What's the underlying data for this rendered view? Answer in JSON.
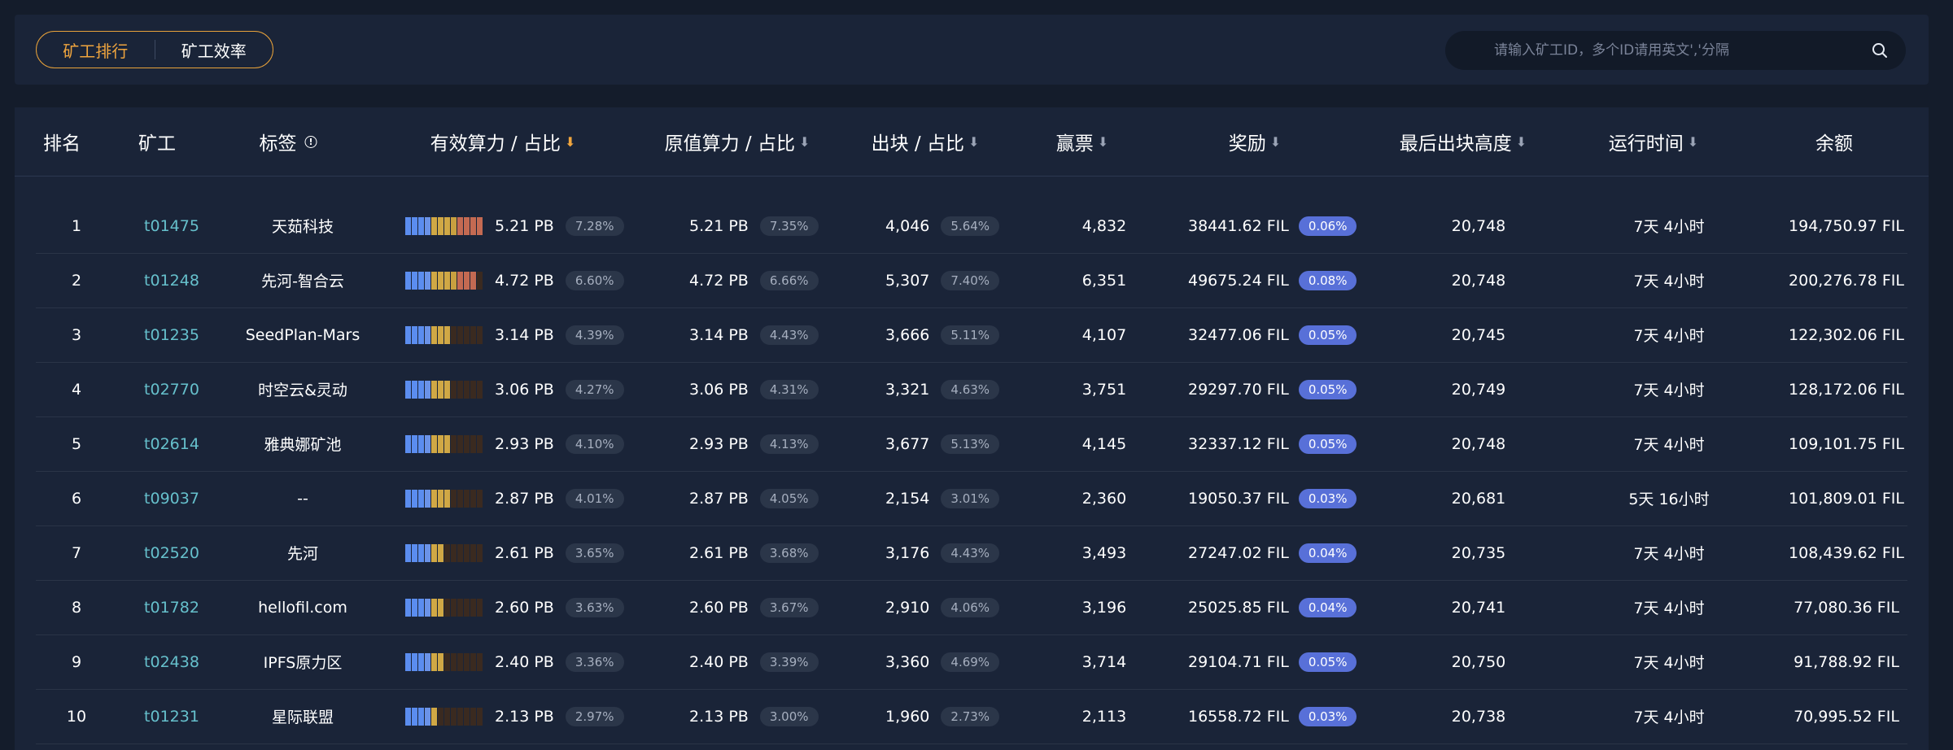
{
  "tabs": [
    {
      "label": "矿工排行",
      "active": true
    },
    {
      "label": "矿工效率",
      "active": false
    }
  ],
  "search": {
    "placeholder": "请输入矿工ID，多个ID请用英文','分隔",
    "icon": "search-icon"
  },
  "headers": {
    "rank": "排名",
    "miner": "矿工",
    "tag": "标签",
    "eff_power": "有效算力 / 占比",
    "raw_power": "原值算力 / 占比",
    "blocks": "出块 / 占比",
    "wins": "赢票",
    "reward": "奖励",
    "last_height": "最后出块高度",
    "runtime": "运行时间",
    "balance": "余额"
  },
  "colors": {
    "accent": "#f0a53e",
    "miner_link": "#66c0cc",
    "reward_pill": "#5870d8",
    "background": "#141c2b"
  },
  "rows": [
    {
      "rank": "1",
      "miner": "t01475",
      "tag": "天茹科技",
      "eff": "5.21 PB",
      "eff_pct": "7.28%",
      "eff_fraction": 1.0,
      "raw": "5.21 PB",
      "raw_pct": "7.35%",
      "blocks": "4,046",
      "blocks_pct": "5.64%",
      "wins": "4,832",
      "reward": "38441.62 FIL",
      "reward_pct": "0.06%",
      "height": "20,748",
      "runtime": "7天 4小时",
      "balance": "194,750.97 FIL"
    },
    {
      "rank": "2",
      "miner": "t01248",
      "tag": "先河-智合云",
      "eff": "4.72 PB",
      "eff_pct": "6.60%",
      "eff_fraction": 0.91,
      "raw": "4.72 PB",
      "raw_pct": "6.66%",
      "blocks": "5,307",
      "blocks_pct": "7.40%",
      "wins": "6,351",
      "reward": "49675.24 FIL",
      "reward_pct": "0.08%",
      "height": "20,748",
      "runtime": "7天 4小时",
      "balance": "200,276.78 FIL"
    },
    {
      "rank": "3",
      "miner": "t01235",
      "tag": "SeedPlan-Mars",
      "eff": "3.14 PB",
      "eff_pct": "4.39%",
      "eff_fraction": 0.6,
      "raw": "3.14 PB",
      "raw_pct": "4.43%",
      "blocks": "3,666",
      "blocks_pct": "5.11%",
      "wins": "4,107",
      "reward": "32477.06 FIL",
      "reward_pct": "0.05%",
      "height": "20,745",
      "runtime": "7天 4小时",
      "balance": "122,302.06 FIL"
    },
    {
      "rank": "4",
      "miner": "t02770",
      "tag": "时空云&灵动",
      "eff": "3.06 PB",
      "eff_pct": "4.27%",
      "eff_fraction": 0.59,
      "raw": "3.06 PB",
      "raw_pct": "4.31%",
      "blocks": "3,321",
      "blocks_pct": "4.63%",
      "wins": "3,751",
      "reward": "29297.70 FIL",
      "reward_pct": "0.05%",
      "height": "20,749",
      "runtime": "7天 4小时",
      "balance": "128,172.06 FIL"
    },
    {
      "rank": "5",
      "miner": "t02614",
      "tag": "雅典娜矿池",
      "eff": "2.93 PB",
      "eff_pct": "4.10%",
      "eff_fraction": 0.56,
      "raw": "2.93 PB",
      "raw_pct": "4.13%",
      "blocks": "3,677",
      "blocks_pct": "5.13%",
      "wins": "4,145",
      "reward": "32337.12 FIL",
      "reward_pct": "0.05%",
      "height": "20,748",
      "runtime": "7天 4小时",
      "balance": "109,101.75 FIL"
    },
    {
      "rank": "6",
      "miner": "t09037",
      "tag": "--",
      "eff": "2.87 PB",
      "eff_pct": "4.01%",
      "eff_fraction": 0.55,
      "raw": "2.87 PB",
      "raw_pct": "4.05%",
      "blocks": "2,154",
      "blocks_pct": "3.01%",
      "wins": "2,360",
      "reward": "19050.37 FIL",
      "reward_pct": "0.03%",
      "height": "20,681",
      "runtime": "5天 16小时",
      "balance": "101,809.01 FIL"
    },
    {
      "rank": "7",
      "miner": "t02520",
      "tag": "先河",
      "eff": "2.61 PB",
      "eff_pct": "3.65%",
      "eff_fraction": 0.5,
      "raw": "2.61 PB",
      "raw_pct": "3.68%",
      "blocks": "3,176",
      "blocks_pct": "4.43%",
      "wins": "3,493",
      "reward": "27247.02 FIL",
      "reward_pct": "0.04%",
      "height": "20,735",
      "runtime": "7天 4小时",
      "balance": "108,439.62 FIL"
    },
    {
      "rank": "8",
      "miner": "t01782",
      "tag": "hellofil.com",
      "eff": "2.60 PB",
      "eff_pct": "3.63%",
      "eff_fraction": 0.5,
      "raw": "2.60 PB",
      "raw_pct": "3.67%",
      "blocks": "2,910",
      "blocks_pct": "4.06%",
      "wins": "3,196",
      "reward": "25025.85 FIL",
      "reward_pct": "0.04%",
      "height": "20,741",
      "runtime": "7天 4小时",
      "balance": "77,080.36 FIL"
    },
    {
      "rank": "9",
      "miner": "t02438",
      "tag": "IPFS原力区",
      "eff": "2.40 PB",
      "eff_pct": "3.36%",
      "eff_fraction": 0.46,
      "raw": "2.40 PB",
      "raw_pct": "3.39%",
      "blocks": "3,360",
      "blocks_pct": "4.69%",
      "wins": "3,714",
      "reward": "29104.71 FIL",
      "reward_pct": "0.05%",
      "height": "20,750",
      "runtime": "7天 4小时",
      "balance": "91,788.92 FIL"
    },
    {
      "rank": "10",
      "miner": "t01231",
      "tag": "星际联盟",
      "eff": "2.13 PB",
      "eff_pct": "2.97%",
      "eff_fraction": 0.41,
      "raw": "2.13 PB",
      "raw_pct": "3.00%",
      "blocks": "1,960",
      "blocks_pct": "2.73%",
      "wins": "2,113",
      "reward": "16558.72 FIL",
      "reward_pct": "0.03%",
      "height": "20,738",
      "runtime": "7天 4小时",
      "balance": "70,995.52 FIL"
    }
  ]
}
